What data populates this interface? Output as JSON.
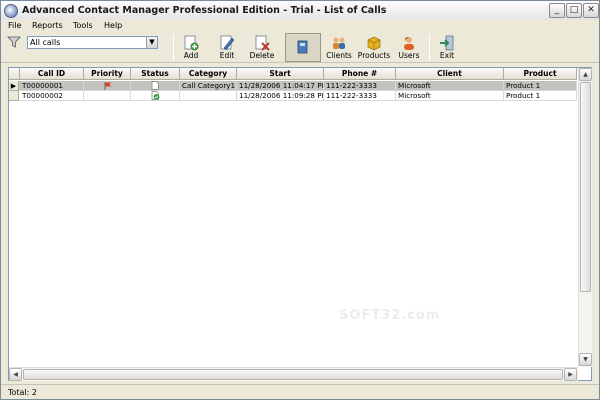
{
  "window": {
    "title": "Advanced Contact Manager Professional Edition - Trial - List of Calls",
    "controls": {
      "minimize": "_",
      "maximize": "□",
      "close": "✕"
    }
  },
  "menu": {
    "items": [
      {
        "label": "File"
      },
      {
        "label": "Reports"
      },
      {
        "label": "Tools"
      },
      {
        "label": "Help"
      }
    ]
  },
  "toolbar": {
    "filter": {
      "value": "All calls",
      "icon": "funnel-icon"
    },
    "buttons": [
      {
        "label": "Add",
        "icon": "add-icon",
        "color": "#3a8f3a"
      },
      {
        "label": "Edit",
        "icon": "edit-icon",
        "color": "#3b6fb0"
      },
      {
        "label": "Delete",
        "icon": "delete-icon",
        "color": "#c0392b"
      },
      {
        "label": "",
        "icon": "calls-icon",
        "color": "#4a7bbf"
      },
      {
        "label": "Clients",
        "icon": "clients-icon",
        "color": "#d8862b"
      },
      {
        "label": "Products",
        "icon": "products-icon",
        "color": "#e6b020"
      },
      {
        "label": "Users",
        "icon": "users-icon",
        "color": "#e0601f"
      },
      {
        "label": "Exit",
        "icon": "exit-icon",
        "color": "#2e8b57"
      }
    ]
  },
  "grid": {
    "columns": [
      {
        "label": "Call ID"
      },
      {
        "label": "Priority"
      },
      {
        "label": "Status"
      },
      {
        "label": "Category"
      },
      {
        "label": "Start"
      },
      {
        "label": "Phone #"
      },
      {
        "label": "Client"
      },
      {
        "label": "Product"
      }
    ],
    "rows": [
      {
        "call_id": "T00000001",
        "priority": "flag",
        "status": "new",
        "category": "Call Category1",
        "start": "11/28/2006 11:04:17 PM",
        "phone": "111-222-3333",
        "client": "Microsoft",
        "product": "Product 1",
        "selected": true
      },
      {
        "call_id": "T00000002",
        "priority": "",
        "status": "done",
        "category": "",
        "start": "11/28/2006 11:09:28 PM",
        "phone": "111-222-3333",
        "client": "Microsoft",
        "product": "Product 1",
        "selected": false
      }
    ]
  },
  "watermark": "SOFT32.com",
  "status": {
    "text": "Total: 2"
  },
  "colors": {
    "selection": "#c4c2bd",
    "chrome": "#ece9d8",
    "grid_border": "#7f9db9"
  }
}
